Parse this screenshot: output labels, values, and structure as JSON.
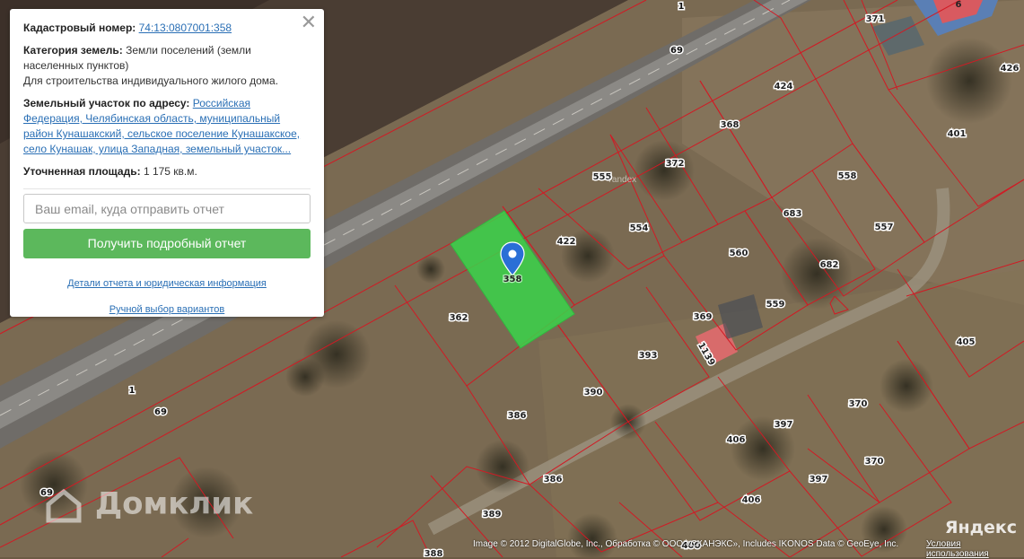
{
  "panel": {
    "cadastral_label": "Кадастровый номер:",
    "cadastral_value": "74:13:0807001:358",
    "category_label": "Категория земель:",
    "category_value": "Земли поселений (земли населенных пунктов)",
    "purpose": "Для строительства индивидуального жилого дома.",
    "address_label": "Земельный участок по адресу:",
    "address_value": "Российская Федерация, Челябинская область, муниципальный район Кунашакский, сельское поселение Кунашакское, село Кунашак, улица Западная, земельный участок...",
    "area_label": "Уточненная площадь:",
    "area_value": "1 175 кв.м.",
    "email_placeholder": "Ваш email, куда отправить отчет",
    "report_button": "Получить подробный отчет",
    "details_link": "Детали отчета и юридическая информация",
    "manual_link": "Ручной выбор вариантов",
    "close_icon": "close-icon"
  },
  "map": {
    "selected_plot": "358",
    "road_labels": [
      "1",
      "69",
      "1",
      "69",
      "69"
    ],
    "plot_labels": [
      "371",
      "426",
      "424",
      "368",
      "401",
      "555",
      "372",
      "558",
      "554",
      "422",
      "683",
      "557",
      "560",
      "682",
      "362",
      "369",
      "559",
      "1139",
      "393",
      "405",
      "390",
      "386",
      "370",
      "397",
      "406",
      "370",
      "397",
      "386",
      "406",
      "389",
      "388",
      "400"
    ],
    "faint_label": "Yandex",
    "building_label": "6"
  },
  "footer": {
    "watermark": "Домклик",
    "yandex_logo": "Яндекс",
    "copyright": "Image © 2012 DigitalGlobe, Inc., Обработка © ООО «СКАНЭКС», Includes IKONOS Data © GeoEye, Inc.",
    "terms": "Условия использования"
  },
  "colors": {
    "plot_border": "#d11a24",
    "selected_fill": "#3ad44a",
    "button": "#5cb85c",
    "link": "#2a6fb5"
  }
}
